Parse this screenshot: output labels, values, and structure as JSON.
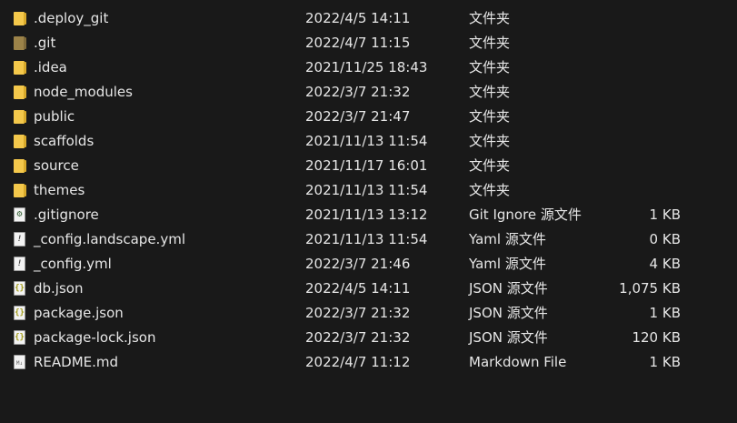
{
  "files": [
    {
      "icon": "folder-icon",
      "name": ".deploy_git",
      "date": "2022/4/5 14:11",
      "type": "文件夹",
      "size": ""
    },
    {
      "icon": "folder-icon",
      "name": ".git",
      "date": "2022/4/7 11:15",
      "type": "文件夹",
      "size": ""
    },
    {
      "icon": "folder-icon",
      "name": ".idea",
      "date": "2021/11/25 18:43",
      "type": "文件夹",
      "size": ""
    },
    {
      "icon": "folder-icon",
      "name": "node_modules",
      "date": "2022/3/7 21:32",
      "type": "文件夹",
      "size": ""
    },
    {
      "icon": "folder-icon",
      "name": "public",
      "date": "2022/3/7 21:47",
      "type": "文件夹",
      "size": ""
    },
    {
      "icon": "folder-icon",
      "name": "scaffolds",
      "date": "2021/11/13 11:54",
      "type": "文件夹",
      "size": ""
    },
    {
      "icon": "folder-icon",
      "name": "source",
      "date": "2021/11/17 16:01",
      "type": "文件夹",
      "size": ""
    },
    {
      "icon": "folder-icon",
      "name": "themes",
      "date": "2021/11/13 11:54",
      "type": "文件夹",
      "size": ""
    },
    {
      "icon": "gear-file-icon",
      "name": ".gitignore",
      "date": "2021/11/13 13:12",
      "type": "Git Ignore 源文件",
      "size": "1 KB"
    },
    {
      "icon": "yaml-file-icon",
      "name": "_config.landscape.yml",
      "date": "2021/11/13 11:54",
      "type": "Yaml 源文件",
      "size": "0 KB"
    },
    {
      "icon": "yaml-file-icon",
      "name": "_config.yml",
      "date": "2022/3/7 21:46",
      "type": "Yaml 源文件",
      "size": "4 KB"
    },
    {
      "icon": "json-file-icon",
      "name": "db.json",
      "date": "2022/4/5 14:11",
      "type": "JSON 源文件",
      "size": "1,075 KB"
    },
    {
      "icon": "json-file-icon",
      "name": "package.json",
      "date": "2022/3/7 21:32",
      "type": "JSON 源文件",
      "size": "1 KB"
    },
    {
      "icon": "json-file-icon",
      "name": "package-lock.json",
      "date": "2022/3/7 21:32",
      "type": "JSON 源文件",
      "size": "120 KB"
    },
    {
      "icon": "markdown-file-icon",
      "name": "README.md",
      "date": "2022/4/7 11:12",
      "type": "Markdown File",
      "size": "1 KB"
    }
  ],
  "colors": {
    "background": "#191919",
    "text": "#e6e6e6",
    "folder": "#f4c84b"
  }
}
